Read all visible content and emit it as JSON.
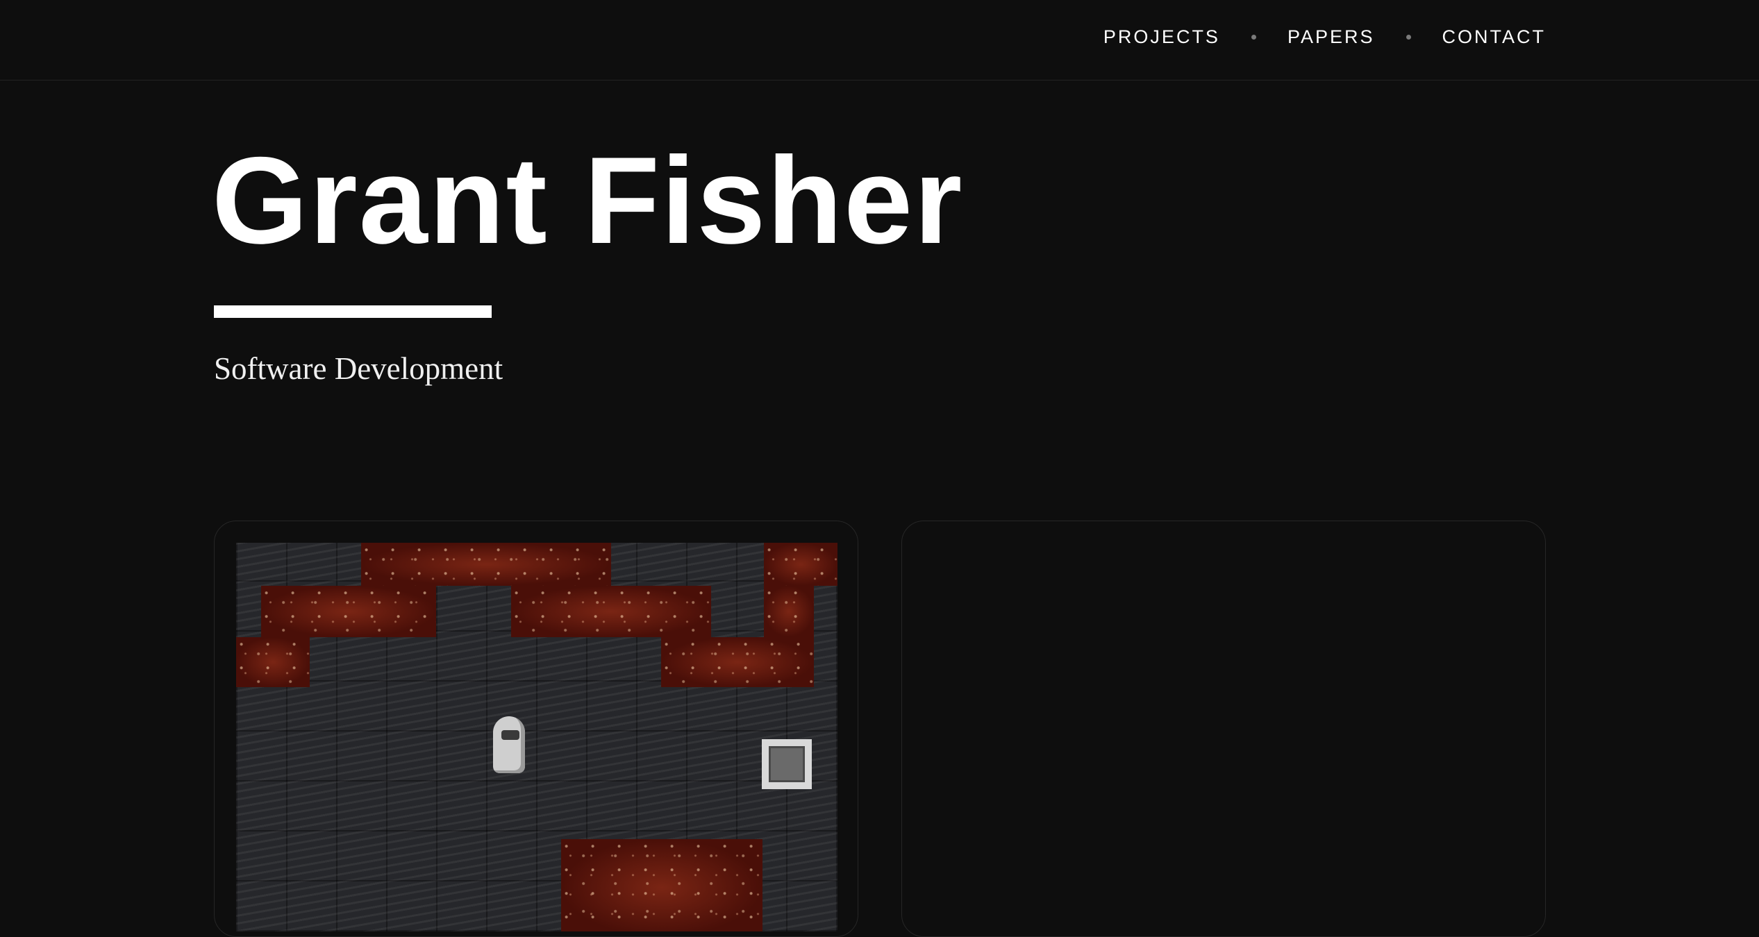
{
  "nav": {
    "items": [
      {
        "label": "PROJECTS"
      },
      {
        "label": "PAPERS"
      },
      {
        "label": "CONTACT"
      }
    ]
  },
  "hero": {
    "title": "Grant Fisher",
    "subtitle": "Software Development"
  },
  "colors": {
    "background": "#0e0e0e",
    "text": "#ffffff",
    "lava": "#5a150c",
    "floor": "#26272b"
  }
}
